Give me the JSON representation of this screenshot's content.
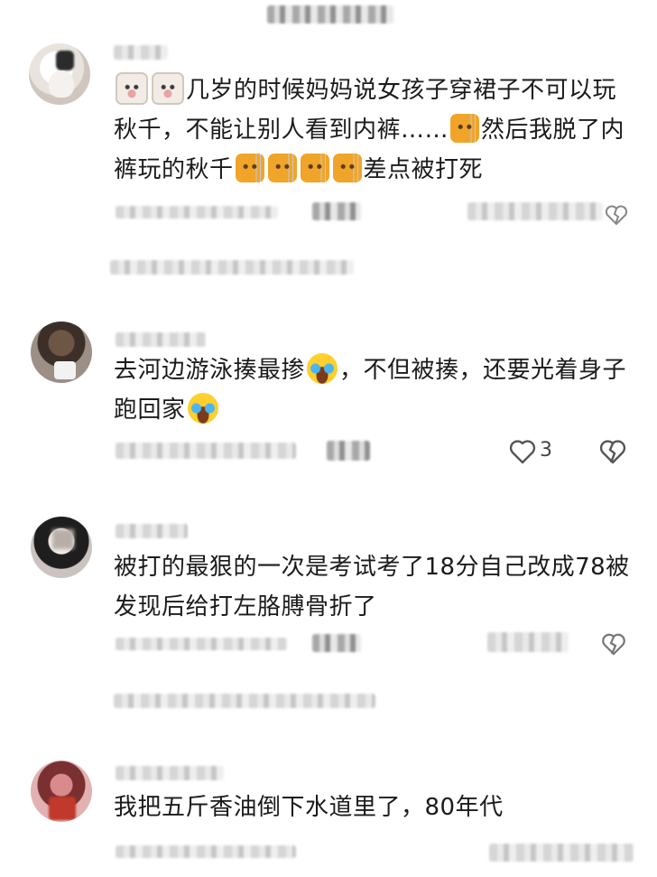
{
  "comments": [
    {
      "text_parts": [
        "几岁的时候妈妈说女孩子穿裙子不可以玩秋千，不能让别人看到内裤……",
        "然后我脱了内裤玩的秋千",
        "差点被打死"
      ]
    },
    {
      "text_parts": [
        "去河边游泳揍最掺",
        "，不但被揍，还要光着身子跑回家"
      ],
      "likes": "3"
    },
    {
      "text_parts": [
        "被打的最狠的一次是考试考了18分自己改成78被发现后给打左胳膊骨折了"
      ]
    },
    {
      "text_parts": [
        "我把五斤香油倒下水道里了，80年代"
      ]
    }
  ],
  "colors": {
    "text": "#1b1b1b",
    "meta": "#9a9a9a",
    "icon": "#555555"
  },
  "icons": [
    "cat-emoji-icon",
    "bear-emoji-icon",
    "crying-emoji-icon",
    "heart-icon",
    "broken-heart-icon"
  ]
}
